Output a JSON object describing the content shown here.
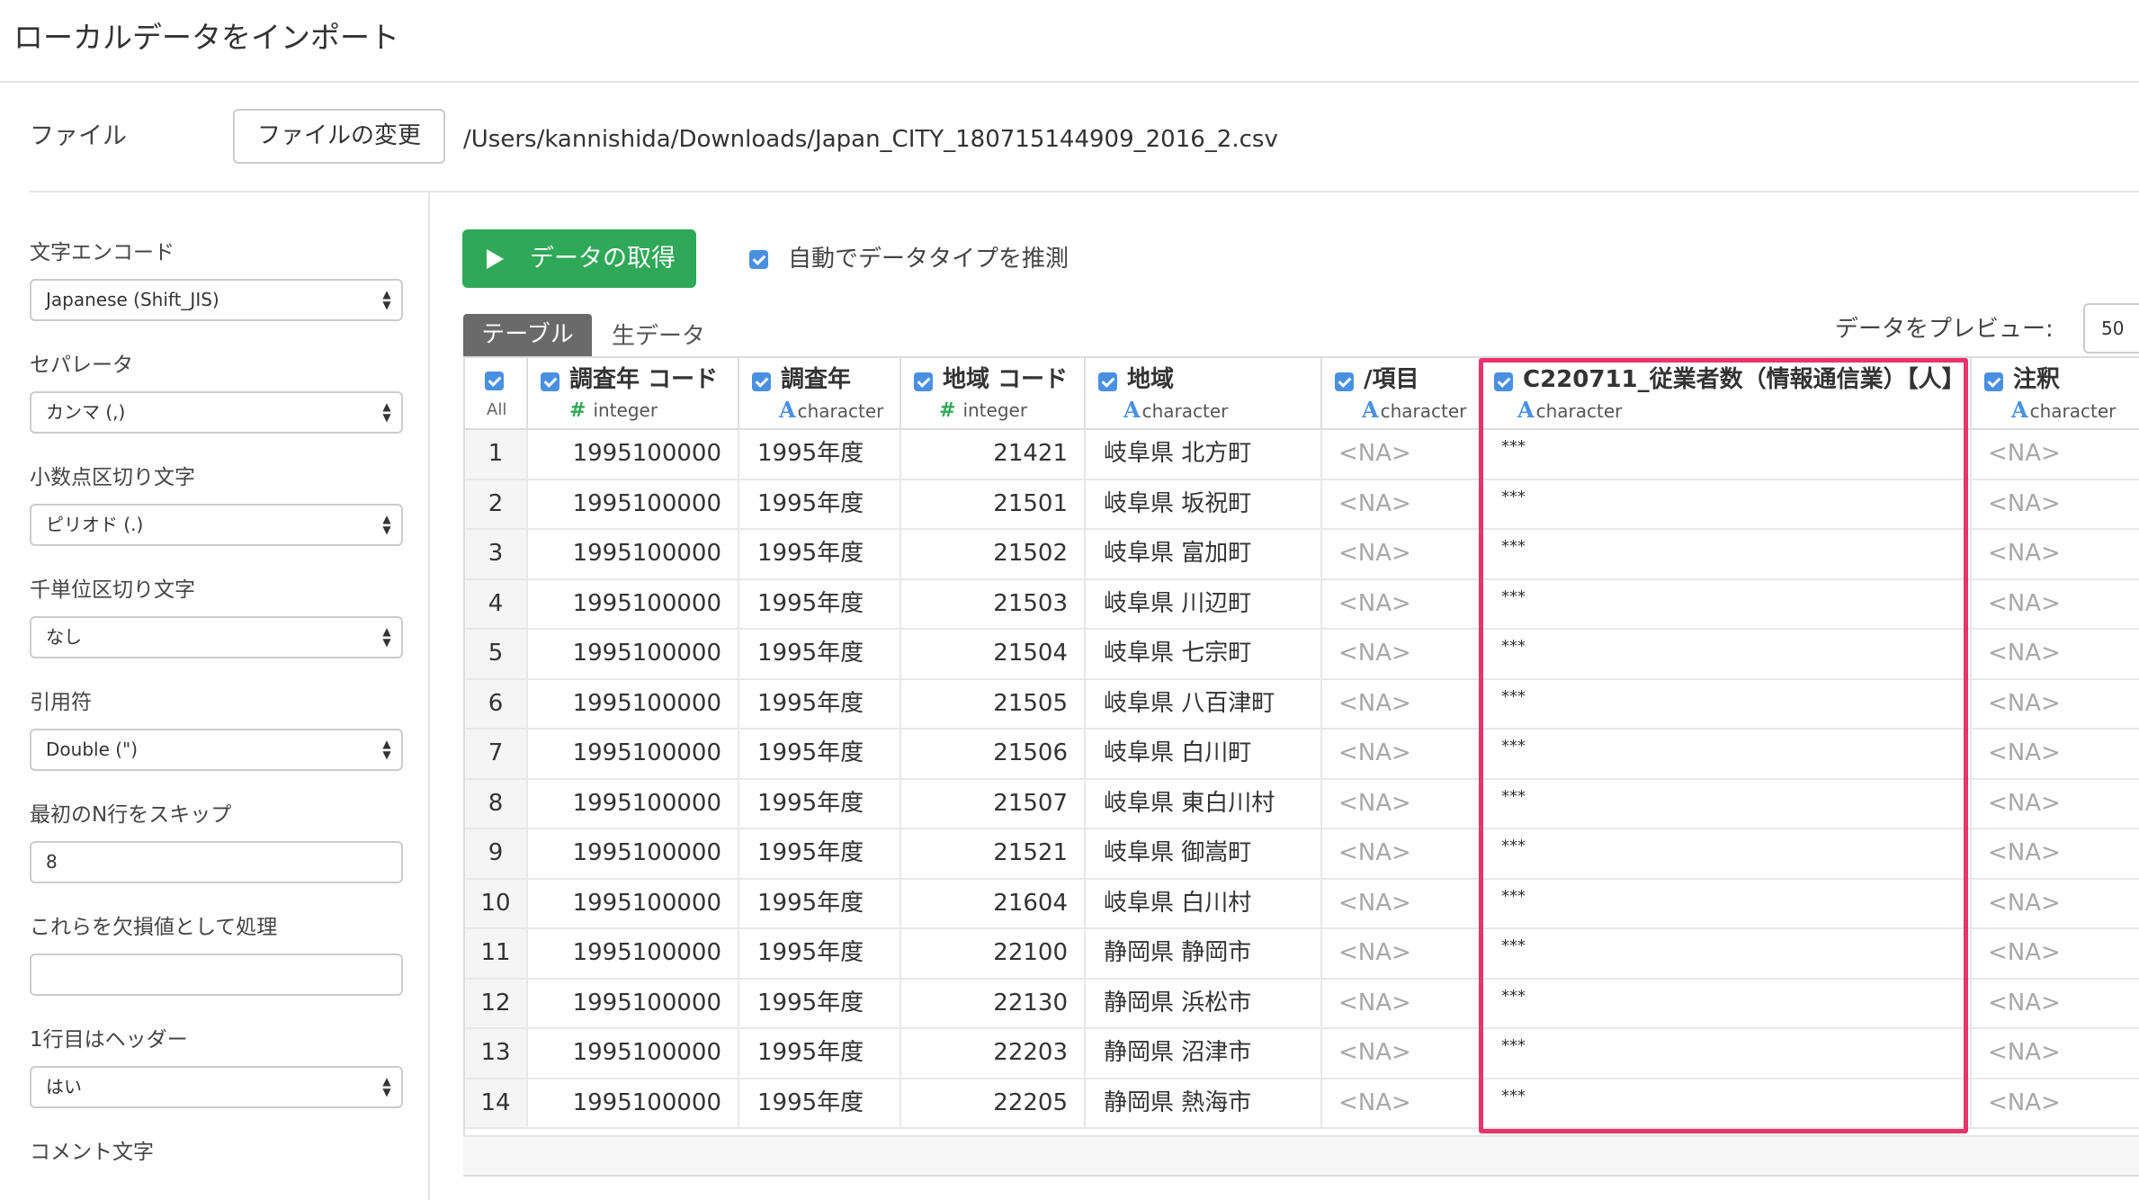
{
  "title": "ローカルデータをインポート",
  "file": {
    "label": "ファイル",
    "change_button": "ファイルの変更",
    "path": "/Users/kannishida/Downloads/Japan_CITY_180715144909_2016_2.csv"
  },
  "sidebar": {
    "encoding": {
      "label": "文字エンコード",
      "value": "Japanese (Shift_JIS)"
    },
    "separator": {
      "label": "セパレータ",
      "value": "カンマ (,)"
    },
    "decimal": {
      "label": "小数点区切り文字",
      "value": "ピリオド (.)"
    },
    "thousands": {
      "label": "千単位区切り文字",
      "value": "なし"
    },
    "quote": {
      "label": "引用符",
      "value": "Double (\")"
    },
    "skip": {
      "label": "最初のN行をスキップ",
      "value": "8"
    },
    "na_values": {
      "label": "これらを欠損値として処理",
      "value": ""
    },
    "header": {
      "label": "1行目はヘッダー",
      "value": "はい"
    },
    "comment": {
      "label": "コメント文字"
    }
  },
  "actions": {
    "get_data": "データの取得",
    "auto_guess": "自動でデータタイプを推測"
  },
  "tabs": {
    "table": "テーブル",
    "raw": "生データ"
  },
  "preview": {
    "label": "データをプレビュー:",
    "count": "50"
  },
  "table": {
    "all_label": "All",
    "columns": [
      {
        "name": "調査年 コード",
        "type": "integer",
        "icon": "#"
      },
      {
        "name": "調査年",
        "type": "character",
        "icon": "A"
      },
      {
        "name": "地域 コード",
        "type": "integer",
        "icon": "#"
      },
      {
        "name": "地域",
        "type": "character",
        "icon": "A"
      },
      {
        "name": "/項目",
        "type": "character",
        "icon": "A"
      },
      {
        "name": "C220711_従業者数（情報通信業）【人】",
        "type": "character",
        "icon": "A"
      },
      {
        "name": "注釈",
        "type": "character",
        "icon": "A"
      }
    ],
    "rows": [
      {
        "n": "1",
        "c1": "1995100000",
        "c2": "1995年度",
        "c3": "21421",
        "c4": "岐阜県 北方町",
        "c5": "<NA>",
        "c6": "***",
        "c7": "<NA>"
      },
      {
        "n": "2",
        "c1": "1995100000",
        "c2": "1995年度",
        "c3": "21501",
        "c4": "岐阜県 坂祝町",
        "c5": "<NA>",
        "c6": "***",
        "c7": "<NA>"
      },
      {
        "n": "3",
        "c1": "1995100000",
        "c2": "1995年度",
        "c3": "21502",
        "c4": "岐阜県 富加町",
        "c5": "<NA>",
        "c6": "***",
        "c7": "<NA>"
      },
      {
        "n": "4",
        "c1": "1995100000",
        "c2": "1995年度",
        "c3": "21503",
        "c4": "岐阜県 川辺町",
        "c5": "<NA>",
        "c6": "***",
        "c7": "<NA>"
      },
      {
        "n": "5",
        "c1": "1995100000",
        "c2": "1995年度",
        "c3": "21504",
        "c4": "岐阜県 七宗町",
        "c5": "<NA>",
        "c6": "***",
        "c7": "<NA>"
      },
      {
        "n": "6",
        "c1": "1995100000",
        "c2": "1995年度",
        "c3": "21505",
        "c4": "岐阜県 八百津町",
        "c5": "<NA>",
        "c6": "***",
        "c7": "<NA>"
      },
      {
        "n": "7",
        "c1": "1995100000",
        "c2": "1995年度",
        "c3": "21506",
        "c4": "岐阜県 白川町",
        "c5": "<NA>",
        "c6": "***",
        "c7": "<NA>"
      },
      {
        "n": "8",
        "c1": "1995100000",
        "c2": "1995年度",
        "c3": "21507",
        "c4": "岐阜県 東白川村",
        "c5": "<NA>",
        "c6": "***",
        "c7": "<NA>"
      },
      {
        "n": "9",
        "c1": "1995100000",
        "c2": "1995年度",
        "c3": "21521",
        "c4": "岐阜県 御嵩町",
        "c5": "<NA>",
        "c6": "***",
        "c7": "<NA>"
      },
      {
        "n": "10",
        "c1": "1995100000",
        "c2": "1995年度",
        "c3": "21604",
        "c4": "岐阜県 白川村",
        "c5": "<NA>",
        "c6": "***",
        "c7": "<NA>"
      },
      {
        "n": "11",
        "c1": "1995100000",
        "c2": "1995年度",
        "c3": "22100",
        "c4": "静岡県 静岡市",
        "c5": "<NA>",
        "c6": "***",
        "c7": "<NA>"
      },
      {
        "n": "12",
        "c1": "1995100000",
        "c2": "1995年度",
        "c3": "22130",
        "c4": "静岡県 浜松市",
        "c5": "<NA>",
        "c6": "***",
        "c7": "<NA>"
      },
      {
        "n": "13",
        "c1": "1995100000",
        "c2": "1995年度",
        "c3": "22203",
        "c4": "静岡県 沼津市",
        "c5": "<NA>",
        "c6": "***",
        "c7": "<NA>"
      },
      {
        "n": "14",
        "c1": "1995100000",
        "c2": "1995年度",
        "c3": "22205",
        "c4": "静岡県 熱海市",
        "c5": "<NA>",
        "c6": "***",
        "c7": "<NA>"
      }
    ]
  },
  "colors": {
    "primary_button": "#2fa957",
    "checkbox": "#4a90e2",
    "highlight": "#e8336d",
    "active_tab": "#6a6a6a"
  }
}
